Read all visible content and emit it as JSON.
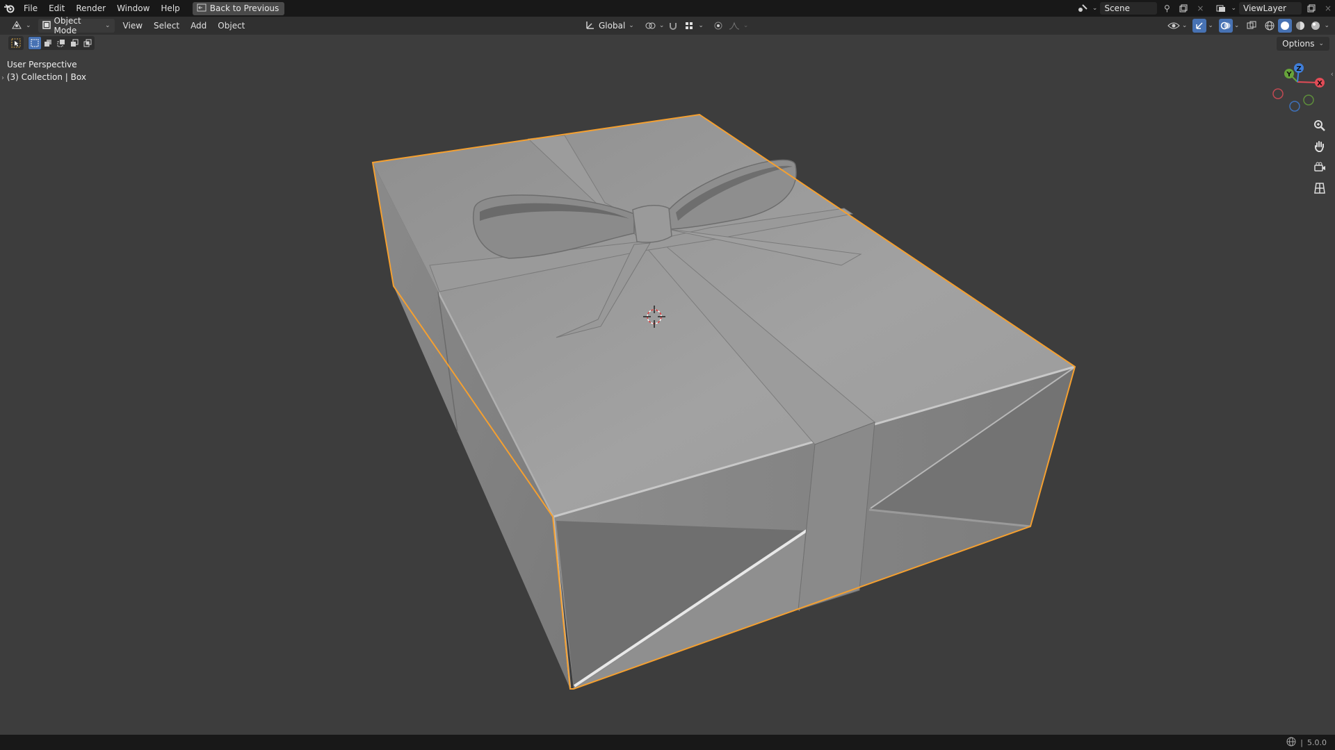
{
  "topbar": {
    "menus": [
      "File",
      "Edit",
      "Render",
      "Window",
      "Help"
    ],
    "back_label": "Back to Previous",
    "scene": "Scene",
    "view_layer": "ViewLayer"
  },
  "header": {
    "mode": "Object Mode",
    "menus": [
      "View",
      "Select",
      "Add",
      "Object"
    ],
    "orientation": "Global",
    "options_label": "Options"
  },
  "viewport": {
    "perspective": "User Perspective",
    "collection": "(3) Collection | Box",
    "selection_outline_color": "#f5a030",
    "background_color": "#3d3d3d"
  },
  "gizmo": {
    "x": "X",
    "y": "Y",
    "z": "Z"
  },
  "status": {
    "version": "5.0.0"
  }
}
